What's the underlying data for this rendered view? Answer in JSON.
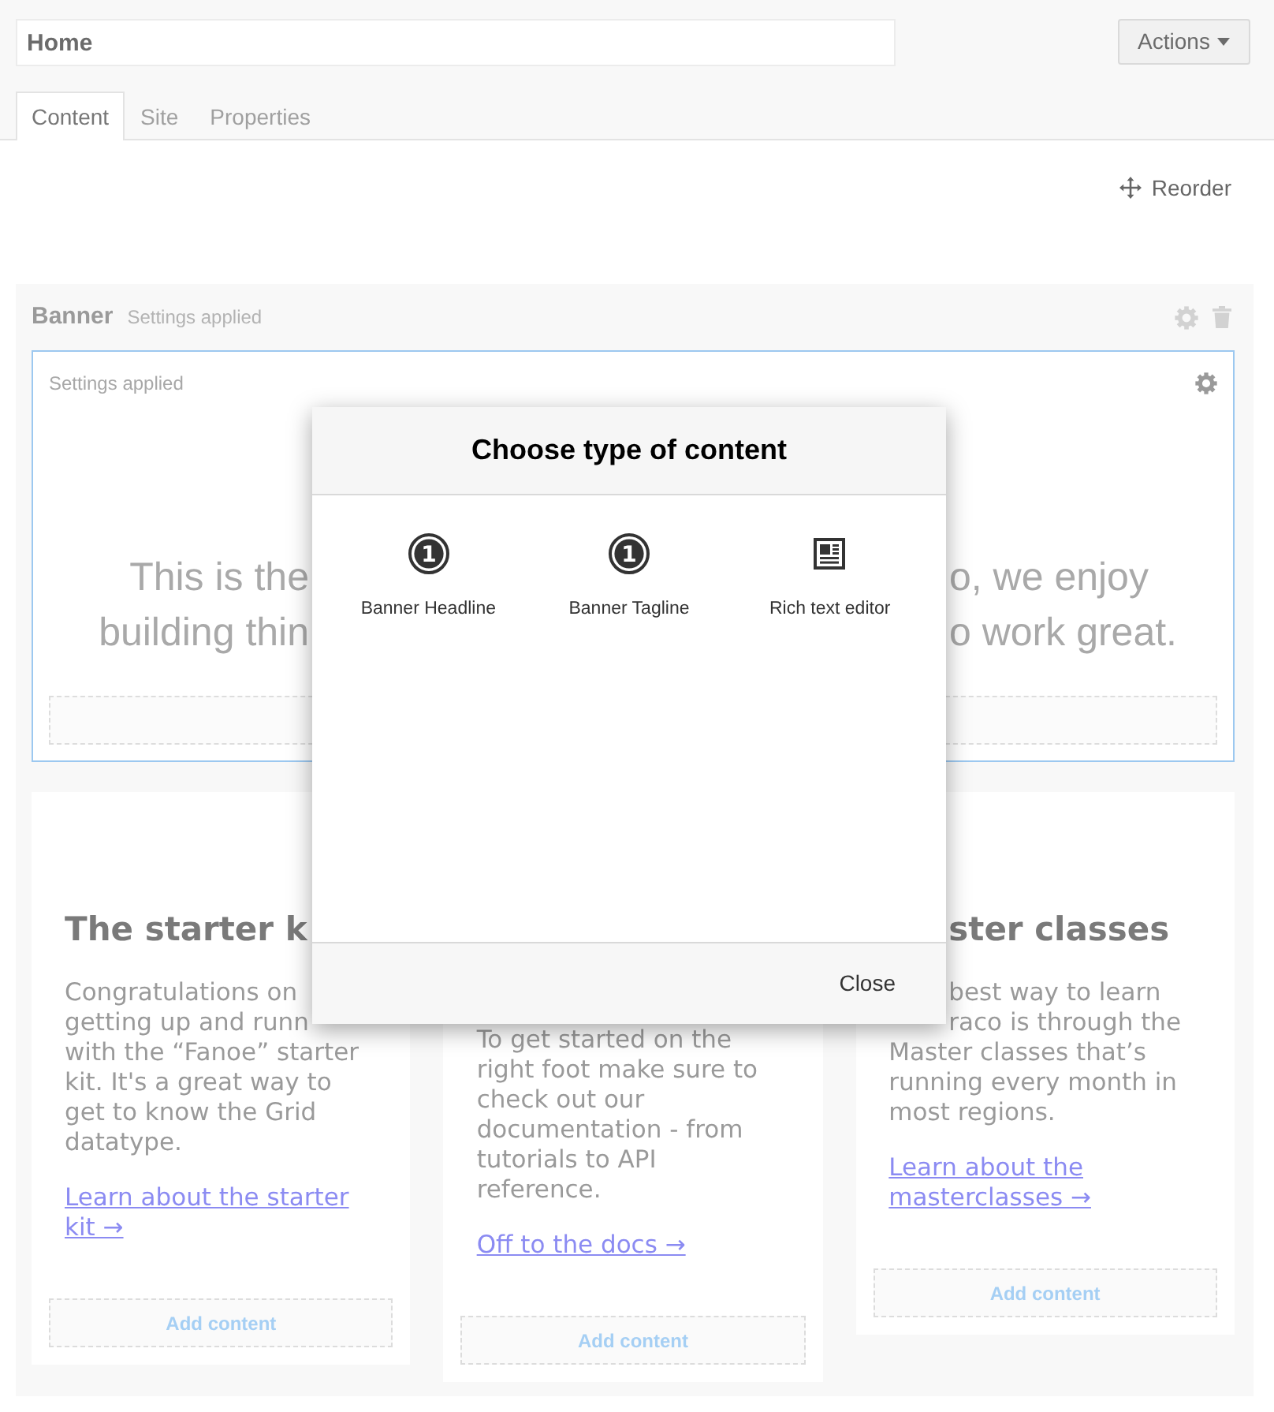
{
  "header": {
    "name_field": {
      "value": "Home"
    },
    "actions_button": {
      "label": "Actions"
    }
  },
  "tabs": [
    {
      "label": "Content",
      "selected": true
    },
    {
      "label": "Site",
      "selected": false
    },
    {
      "label": "Properties",
      "selected": false
    }
  ],
  "toolbar": {
    "reorder_button": {
      "label": "Reorder"
    }
  },
  "banner_section": {
    "title": "Banner",
    "settings_note": "Settings applied",
    "banner_row": {
      "settings_note": "Settings applied",
      "text_lines": [
        {
          "start": "This is the",
          "end": "o, we enjoy"
        },
        {
          "start": "building thin",
          "end": "o work great."
        }
      ]
    }
  },
  "cards": [
    {
      "heading": {
        "kind": "line",
        "text": "The starter k"
      },
      "text_lines": [
        {
          "kind": "line",
          "text": "Congratulations on"
        },
        {
          "kind": "line",
          "text": "getting up and runn"
        },
        {
          "kind": "line",
          "text": "with the “Fanoe” starter"
        },
        {
          "kind": "line",
          "text": "kit. It's a great way to"
        },
        {
          "kind": "line",
          "text": "get to know the Grid"
        },
        {
          "kind": "line",
          "text": "datatype."
        }
      ],
      "link": "Learn about the starter kit →",
      "add_button": "Add content"
    },
    {
      "text_lines": [
        {
          "kind": "line",
          "text": "To get started on the"
        },
        {
          "kind": "line",
          "text": "right foot make sure to"
        },
        {
          "kind": "line",
          "text": "check out our"
        },
        {
          "kind": "line",
          "text": "documentation - from"
        },
        {
          "kind": "line",
          "text": "tutorials to API"
        },
        {
          "kind": "line",
          "text": "reference."
        }
      ],
      "link": "Off to the docs →",
      "add_button": "Add content"
    },
    {
      "heading": {
        "kind": "tail",
        "text": "ster classes"
      },
      "text_lines": [
        {
          "kind": "tail",
          "text": "best way to learn"
        },
        {
          "kind": "tail",
          "text": "raco is through the"
        },
        {
          "kind": "line",
          "text": "Master classes that’s"
        },
        {
          "kind": "line",
          "text": "running every month in"
        },
        {
          "kind": "line",
          "text": "most regions."
        }
      ],
      "link": "Learn about the masterclasses →",
      "add_button": "Add content"
    }
  ],
  "dialog": {
    "title": "Choose type of content",
    "items": [
      {
        "kind": "number",
        "number": "1",
        "label": "Banner Headline"
      },
      {
        "kind": "number",
        "number": "1",
        "label": "Banner Tagline"
      },
      {
        "kind": "document",
        "label": "Rich text editor"
      }
    ],
    "close_button": {
      "label": "Close"
    }
  }
}
